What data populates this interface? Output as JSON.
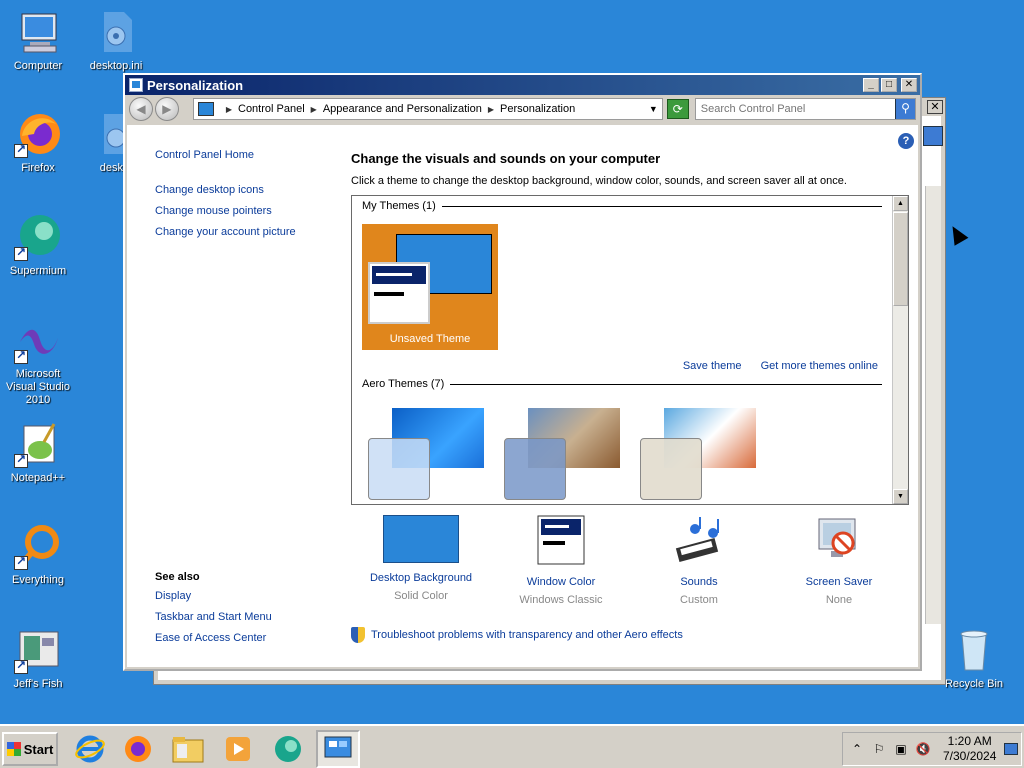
{
  "desktop": {
    "icons": [
      {
        "label": "Computer"
      },
      {
        "label": "desktop.ini"
      },
      {
        "label": "Firefox"
      },
      {
        "label": "deskto"
      },
      {
        "label": "Supermium"
      },
      {
        "label": "Microsoft Visual Studio 2010"
      },
      {
        "label": "Notepad++"
      },
      {
        "label": "Everything"
      },
      {
        "label": "Jeff's Fish"
      },
      {
        "label": "Recycle Bin"
      }
    ]
  },
  "window": {
    "title": "Personalization",
    "breadcrumbs": [
      "Control Panel",
      "Appearance and Personalization",
      "Personalization"
    ],
    "search_placeholder": "Search Control Panel"
  },
  "left_pane": {
    "home": "Control Panel Home",
    "links": [
      "Change desktop icons",
      "Change mouse pointers",
      "Change your account picture"
    ],
    "see_also_title": "See also",
    "see_also": [
      "Display",
      "Taskbar and Start Menu",
      "Ease of Access Center"
    ]
  },
  "main": {
    "heading": "Change the visuals and sounds on your computer",
    "subheading": "Click a theme to change the desktop background, window color, sounds, and screen saver all at once.",
    "my_themes_title": "My Themes (1)",
    "unsaved_theme": "Unsaved Theme",
    "save_theme": "Save theme",
    "get_more": "Get more themes online",
    "aero_themes_title": "Aero Themes (7)"
  },
  "tiles": [
    {
      "name": "Desktop Background",
      "value": "Solid Color",
      "icon": "desktop-background-icon"
    },
    {
      "name": "Window Color",
      "value": "Windows Classic",
      "icon": "window-color-icon"
    },
    {
      "name": "Sounds",
      "value": "Custom",
      "icon": "sounds-icon"
    },
    {
      "name": "Screen Saver",
      "value": "None",
      "icon": "screen-saver-icon"
    }
  ],
  "troubleshoot": "Troubleshoot problems with transparency and other Aero effects",
  "taskbar": {
    "start_label": "Start",
    "time": "1:20 AM",
    "date": "7/30/2024"
  },
  "colors": {
    "desktop": "#2a86d8",
    "link": "#0b3c9a",
    "unsaved_theme_bg": "#e0861c",
    "titlebar_start": "#0a246a"
  }
}
